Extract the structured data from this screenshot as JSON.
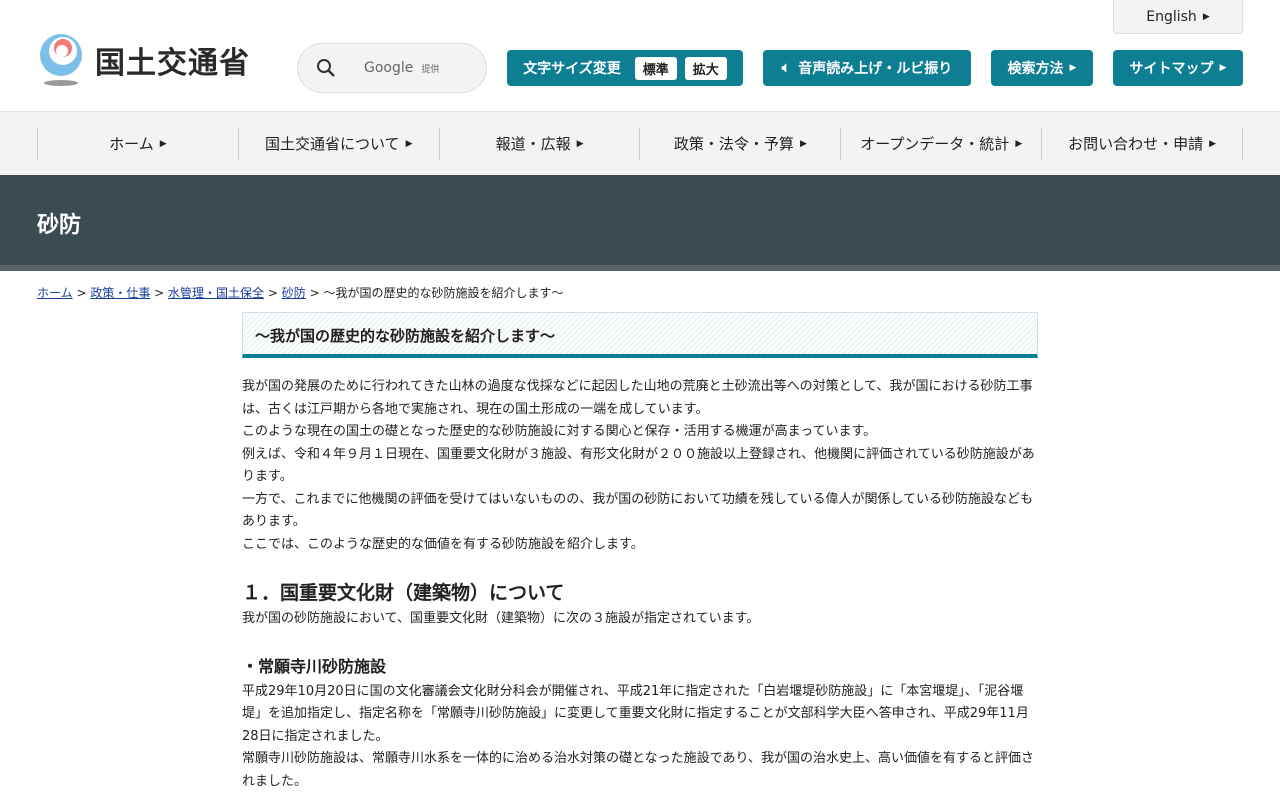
{
  "header": {
    "logo_text": "国土交通省",
    "search_brand": "Google",
    "search_provided": "提供",
    "font_size_label": "文字サイズ変更",
    "font_standard": "標準",
    "font_large": "拡大",
    "read_aloud": "音声読み上げ・ルビ振り",
    "search_method": "検索方法",
    "sitemap": "サイトマップ",
    "english": "English"
  },
  "nav": [
    "ホーム",
    "国土交通省について",
    "報道・広報",
    "政策・法令・予算",
    "オープンデータ・統計",
    "お問い合わせ・申請"
  ],
  "banner": "砂防",
  "breadcrumb": {
    "links": [
      "ホーム",
      "政策・仕事",
      "水管理・国土保全",
      "砂防"
    ],
    "current": "～我が国の歴史的な砂防施設を紹介します～"
  },
  "title": "～我が国の歴史的な砂防施設を紹介します～",
  "intro": [
    "我が国の発展のために行われてきた山林の過度な伐採などに起因した山地の荒廃と土砂流出等への対策として、我が国における砂防工事は、古くは江戸期から各地で実施され、現在の国土形成の一端を成しています。",
    "このような現在の国土の礎となった歴史的な砂防施設に対する関心と保存・活用する機運が高まっています。",
    "例えば、令和４年９月１日現在、国重要文化財が３施設、有形文化財が２００施設以上登録され、他機関に評価されている砂防施設があります。",
    "一方で、これまでに他機関の評価を受けてはいないものの、我が国の砂防において功績を残している偉人が関係している砂防施設などもあります。",
    "ここでは、このような歴史的な価値を有する砂防施設を紹介します。"
  ],
  "section1": {
    "heading": "１．国重要文化財（建築物）について",
    "text": "我が国の砂防施設において、国重要文化財（建築物）に次の３施設が指定されています。"
  },
  "item1": {
    "heading": "常願寺川砂防施設",
    "paragraphs": [
      "平成29年10月20日に国の文化審議会文化財分科会が開催され、平成21年に指定された「白岩堰堤砂防施設」に「本宮堰堤」、「泥谷堰堤」を追加指定し、指定名称を「常願寺川砂防施設」に変更して重要文化財に指定することが文部科学大臣へ答申され、平成29年11月28日に指定されました。",
      "常願寺川砂防施設は、常願寺川水系を一体的に治める治水対策の礎となった施設であり、我が国の治水史上、高い価値を有すると評価されました。"
    ]
  }
}
